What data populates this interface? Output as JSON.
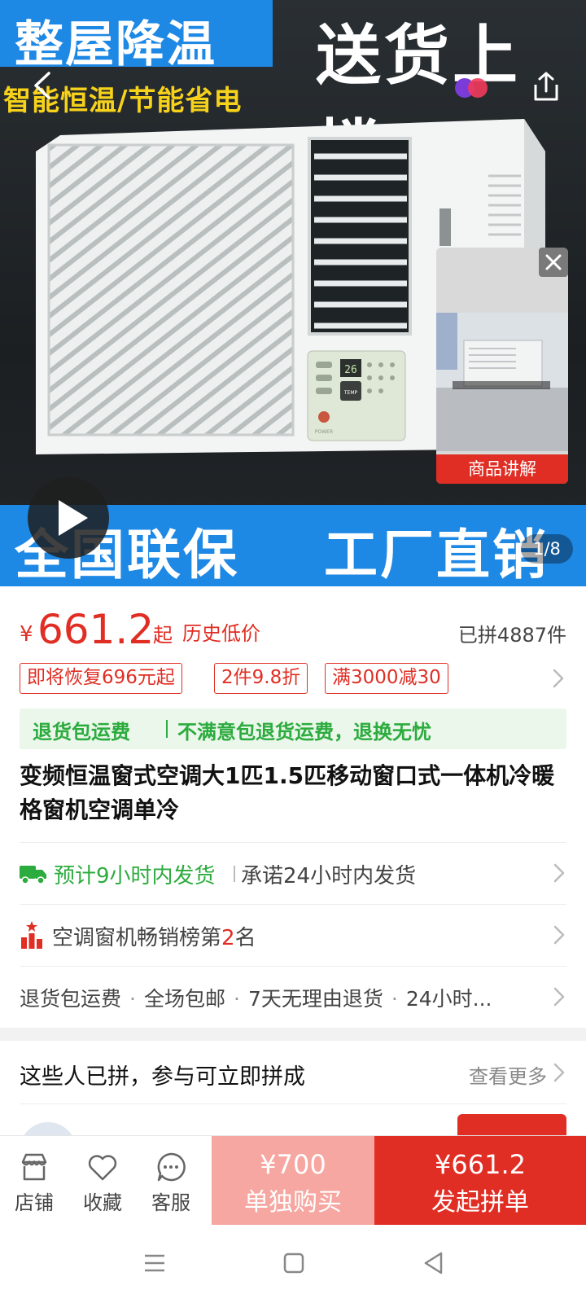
{
  "hero": {
    "banner_top_left": "整屋降温",
    "slogan": "智能恒温/节能省电",
    "banner_top_right": "送货上楼",
    "banner_bottom_left": "全国联保",
    "banner_bottom_right": "工厂直销",
    "image_counter": "1/8",
    "video_label": "商品讲解",
    "ac_display_temp": "26",
    "ac_temp_button": "TEMP",
    "ac_power_label": "POWER"
  },
  "price": {
    "currency": "¥",
    "value": "661.2",
    "suffix": "起",
    "tag": "历史低价",
    "sold": "已拼4887件"
  },
  "promos": [
    "即将恢复696元起",
    "2件9.8折",
    "满3000减30"
  ],
  "refund_banner": {
    "left": "退货包运费",
    "right": "不满意包退货运费，退换无忧"
  },
  "product_title": "变频恒温窗式空调大1匹1.5匹移动窗口式一体机冷暖格窗机空调单冷",
  "shipping": {
    "estimate": "预计9小时内发货",
    "promise": "承诺24小时内发货"
  },
  "ranking": {
    "prefix": "空调窗机畅销榜第",
    "rank": "2",
    "suffix": "名"
  },
  "services": [
    "退货包运费",
    "全场包邮",
    "7天无理由退货",
    "24小时..."
  ],
  "group": {
    "title": "这些人已拼，参与可立即拼成",
    "more": "查看更多"
  },
  "actions": {
    "shop": "店铺",
    "favorite": "收藏",
    "service": "客服",
    "solo_price": "¥700",
    "solo_label": "单独购买",
    "group_price": "¥661.2",
    "group_label": "发起拼单"
  },
  "colors": {
    "brand_red": "#e02e24",
    "success_green": "#2cab3e",
    "banner_blue": "#1e88e5"
  }
}
